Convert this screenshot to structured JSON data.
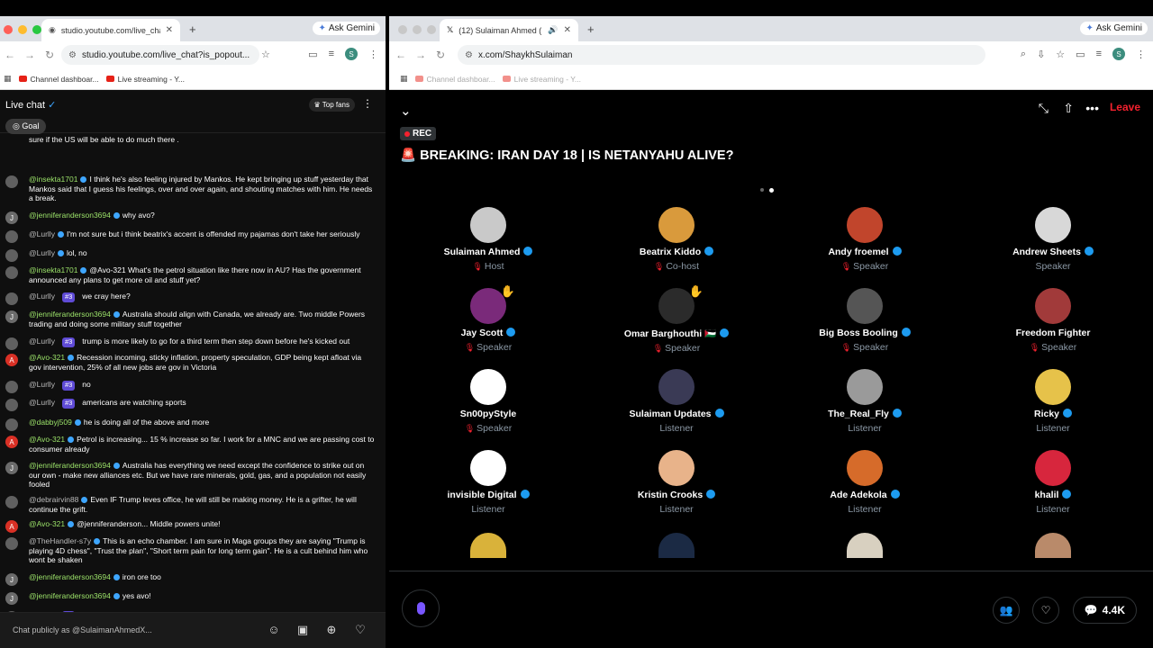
{
  "left": {
    "tab_title": "studio.youtube.com/live_chat",
    "gemini": "Ask Gemini",
    "url": "studio.youtube.com/live_chat?is_popout...",
    "bookmarks": [
      "Channel dashboar...",
      "Live streaming - Y..."
    ],
    "header": {
      "title": "Live chat",
      "top_fans": "Top fans",
      "goal": "Goal"
    },
    "partial_top": "sure if the US will be able to do much there .",
    "messages": [
      {
        "avatar_letter": "",
        "author": "@insekta1701",
        "badge": "",
        "text": "I think he's also feeling injured by Mankos. He kept bringing up stuff yesterday that Mankos said that I guess his feelings, over and over again, and shouting matches with him. He needs a break."
      },
      {
        "avatar_letter": "J",
        "author": "@jenniferanderson3694",
        "badge": "",
        "text": "why avo?"
      },
      {
        "avatar_letter": "",
        "author": "@Lurlly",
        "badge": "",
        "text": "I'm not sure but i think beatrix's accent is offended my pajamas don't take her seriously"
      },
      {
        "avatar_letter": "",
        "author": "@Lurlly",
        "badge": "",
        "text": "lol, no"
      },
      {
        "avatar_letter": "",
        "author": "@insekta1701",
        "badge": "",
        "text": "@Avo-321 What's the petrol situation like there now in AU? Has the government announced any plans to get more oil and stuff yet?"
      },
      {
        "avatar_letter": "",
        "author": "@Lurlly",
        "badge": "#3",
        "text": "we cray here?"
      },
      {
        "avatar_letter": "J",
        "author": "@jenniferanderson3694",
        "badge": "",
        "text": "Australia should align with Canada, we already are. Two middle Powers trading and doing some military stuff together"
      },
      {
        "avatar_letter": "",
        "author": "@Lurlly",
        "badge": "#3",
        "text": "trump is more likely to go for a third term then step down before he's kicked out"
      },
      {
        "avatar_letter": "A",
        "author": "@Avo-321",
        "badge": "",
        "text": "Recession incoming, sticky inflation, property speculation, GDP being kept afloat via gov intervention, 25% of all new jobs are gov in Victoria"
      },
      {
        "avatar_letter": "",
        "author": "@Lurlly",
        "badge": "#3",
        "text": "no"
      },
      {
        "avatar_letter": "",
        "author": "@Lurlly",
        "badge": "#3",
        "text": "americans are watching sports"
      },
      {
        "avatar_letter": "",
        "author": "@dabbyj509",
        "badge": "",
        "text": "he is doing all of the above and more"
      },
      {
        "avatar_letter": "A",
        "author": "@Avo-321",
        "badge": "",
        "text": "Petrol is increasing... 15 % increase so far. I work for a MNC and we are passing cost to consumer already"
      },
      {
        "avatar_letter": "J",
        "author": "@jenniferanderson3694",
        "badge": "",
        "text": "Australia has everything we need except the confidence to strike out on our own - make new alliances etc. But we have rare minerals, gold, gas, and a population not easily fooled"
      },
      {
        "avatar_letter": "",
        "author": "@debrairvin88",
        "badge": "",
        "text": "Even IF Trump leves office, he will still be making money. He is a grifter, he will continue the grift."
      },
      {
        "avatar_letter": "A",
        "author": "@Avo-321",
        "badge": "",
        "text": "@jenniferanderson... Middle powers unite!"
      },
      {
        "avatar_letter": "",
        "author": "@TheHandler-s7y",
        "badge": "",
        "text": "This is an echo chamber. I am sure in Maga groups they are saying \"Trump is playing 4D chess\", \"Trust the plan\", \"Short term pain for long term gain\". He is a cult behind him who wont be shaken"
      },
      {
        "avatar_letter": "J",
        "author": "@jenniferanderson3694",
        "badge": "",
        "text": "iron ore too"
      },
      {
        "avatar_letter": "J",
        "author": "@jenniferanderson3694",
        "badge": "",
        "text": "yes avo!"
      },
      {
        "avatar_letter": "",
        "author": "@Lurlly",
        "badge": "#3",
        "text": "?"
      }
    ],
    "chat_input_placeholder": "Chat publicly as @SulaimanAhmedX..."
  },
  "right": {
    "tab_title": "(12) Sulaiman Ahmed (@S",
    "gemini": "Ask Gemini",
    "url": "x.com/ShaykhSulaiman",
    "bookmarks": [
      "Channel dashboar...",
      "Live streaming - Y..."
    ],
    "leave": "Leave",
    "rec": "REC",
    "space_title": "BREAKING: IRAN DAY 18 | IS NETANYAHU ALIVE?",
    "speakers": [
      {
        "name": "Sulaiman Ahmed",
        "role": "Host",
        "verified": true,
        "mic_off": true,
        "color": "#c9c9c9"
      },
      {
        "name": "Beatrix Kiddo",
        "role": "Co-host",
        "verified": true,
        "mic_off": true,
        "color": "#d99a3c"
      },
      {
        "name": "Andy froemel",
        "role": "Speaker",
        "verified": true,
        "mic_off": true,
        "color": "#c1452c"
      },
      {
        "name": "Andrew Sheets",
        "role": "Speaker",
        "verified": true,
        "mic_off": false,
        "color": "#d8d8d8"
      },
      {
        "name": "Jay Scott",
        "role": "Speaker",
        "verified": true,
        "mic_off": true,
        "color": "#7a2a7a",
        "hand": true
      },
      {
        "name": "Omar Barghouthi 🇵🇸",
        "role": "Speaker",
        "verified": true,
        "mic_off": true,
        "color": "#2b2b2b",
        "hand": true
      },
      {
        "name": "Big Boss Booling",
        "role": "Speaker",
        "verified": true,
        "mic_off": true,
        "color": "#555555"
      },
      {
        "name": "Freedom Fighter",
        "role": "Speaker",
        "verified": false,
        "mic_off": true,
        "color": "#a13a3a"
      },
      {
        "name": "Sn00pyStyle",
        "role": "Speaker",
        "verified": false,
        "mic_off": true,
        "color": "#ffffff"
      },
      {
        "name": "Sulaiman Updates",
        "role": "Listener",
        "verified": true,
        "mic_off": false,
        "color": "#3a3a55"
      },
      {
        "name": "The_Real_Fly",
        "role": "Listener",
        "verified": true,
        "mic_off": false,
        "color": "#9a9a9a"
      },
      {
        "name": "Ricky",
        "role": "Listener",
        "verified": true,
        "mic_off": false,
        "color": "#e6c24a"
      },
      {
        "name": "invisible Digital",
        "role": "Listener",
        "verified": true,
        "mic_off": false,
        "color": "#ffffff"
      },
      {
        "name": "Kristin Crooks",
        "role": "Listener",
        "verified": true,
        "mic_off": false,
        "color": "#e8b38a"
      },
      {
        "name": "Ade Adekola",
        "role": "Listener",
        "verified": true,
        "mic_off": false,
        "color": "#d66b2a"
      },
      {
        "name": "khalil",
        "role": "Listener",
        "verified": true,
        "mic_off": false,
        "color": "#d7263d"
      }
    ],
    "comments": "4.4K"
  }
}
